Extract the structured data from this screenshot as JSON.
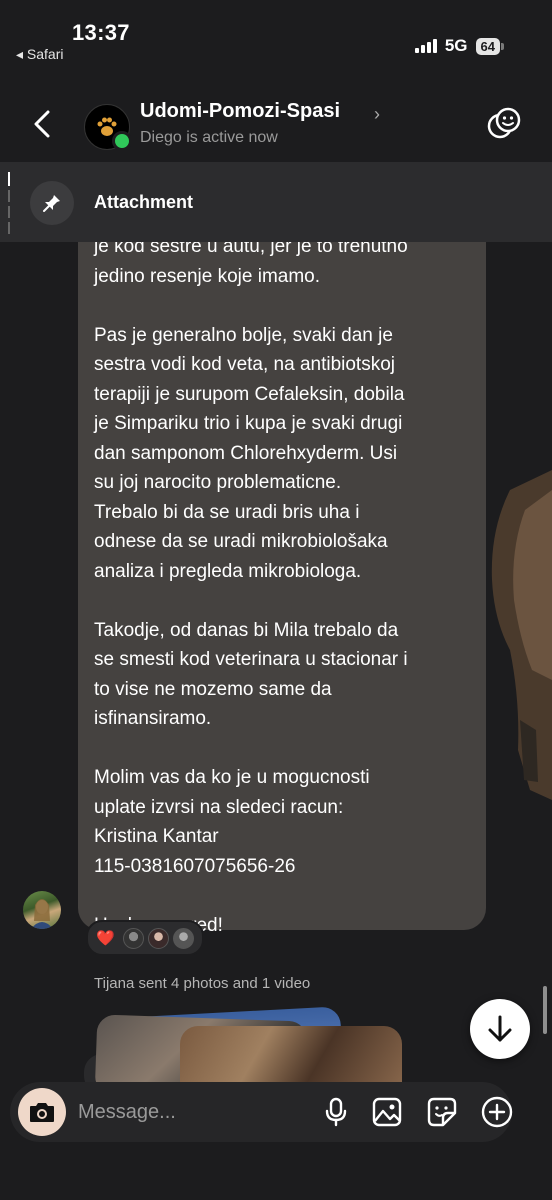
{
  "status_bar": {
    "time": "13:37",
    "back_app": "◂ Safari",
    "network": "5G",
    "battery": "64"
  },
  "header": {
    "title": "Udomi-Pomozi-Spasi",
    "chevron": "›",
    "subtitle": "Diego is active now",
    "icons": [
      "back-chevron-icon",
      "group-avatar",
      "effects-icon"
    ]
  },
  "pinned": {
    "label": "Attachment",
    "icon": "pin-icon"
  },
  "message": {
    "paragraphs": [
      "je kod sestre u autu, jer je to trenutno\njedino resenje koje imamo.",
      "Pas je generalno bolje, svaki dan je\nsestra vodi kod veta, na antibiotskoj\nterapiji je surupom Cefaleksin, dobila\nje Simpariku trio i kupa je svaki drugi\ndan samponom Chlorehxyderm. Usi\nsu joj narocito problematicne.\nTrebalo bi da se uradi bris uha i\nodnese da se uradi mikrobiološaka\nanaliza i pregleda mikrobiologa.",
      "Takodje, od danas bi Mila trebalo da\nse smesti kod veterinara u stacionar i\nto vise ne mozemo same da\nisfinansiramo.",
      "Molim vas da ko je u mogucnosti\nuplate izvrsi na sledeci racun:\nKristina Kantar\n115-0381607075656-26",
      "Hvala unapred!"
    ],
    "reaction_emoji": "❤️"
  },
  "system_note": "Tijana sent 4 photos and 1 video",
  "composer": {
    "placeholder": "Message...",
    "icons": [
      "camera-icon",
      "microphone-icon",
      "gallery-icon",
      "sticker-icon",
      "plus-icon"
    ]
  },
  "colors": {
    "background": "#1c1c1e",
    "bubble": "#454240",
    "online": "#30c85a",
    "heart": "#ff3040"
  }
}
